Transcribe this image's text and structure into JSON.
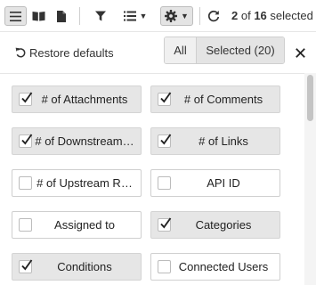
{
  "toolbar": {
    "buttons": [
      {
        "name": "list-view-icon",
        "active": true
      },
      {
        "name": "book-view-icon",
        "active": false
      },
      {
        "name": "document-view-icon",
        "active": false
      },
      {
        "name": "filter-icon",
        "active": false
      },
      {
        "name": "list-options-icon",
        "active": false
      },
      {
        "name": "gear-icon",
        "active": true
      },
      {
        "name": "refresh-icon",
        "active": false
      }
    ],
    "selected_count": "2",
    "selected_of": "of",
    "selected_total": "16",
    "selected_suffix": "selected"
  },
  "panel": {
    "restore_label": "Restore defaults",
    "filter_all_label": "All",
    "filter_selected_label": "Selected (20)",
    "close_icon": "close-icon"
  },
  "fields": [
    {
      "label": "# of Attachments",
      "checked": true
    },
    {
      "label": "# of Comments",
      "checked": true
    },
    {
      "label": "# of Downstream…",
      "checked": true
    },
    {
      "label": "# of Links",
      "checked": true
    },
    {
      "label": "# of Upstream R…",
      "checked": false
    },
    {
      "label": "API ID",
      "checked": false
    },
    {
      "label": "Assigned to",
      "checked": false
    },
    {
      "label": "Categories",
      "checked": true
    },
    {
      "label": "Conditions",
      "checked": true
    },
    {
      "label": "Connected Users",
      "checked": false
    }
  ],
  "colors": {
    "checked_bg": "#e6e6e6",
    "unchecked_bg": "#ffffff",
    "active_button_bg": "#e4e4e4"
  }
}
